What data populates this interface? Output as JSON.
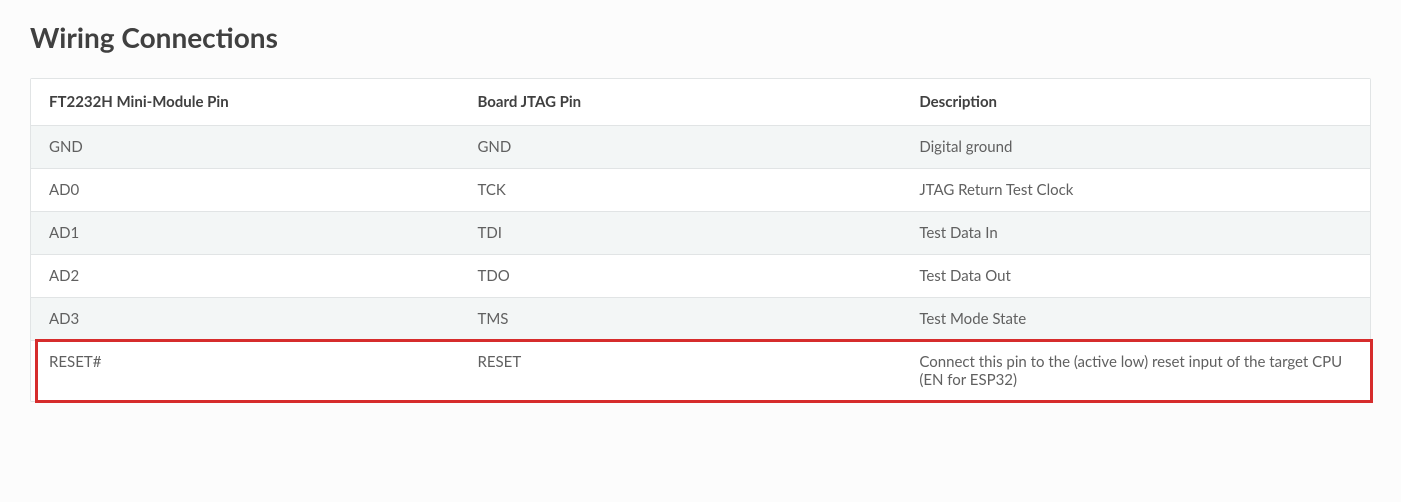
{
  "heading": "Wiring Connections",
  "table": {
    "headers": [
      "FT2232H Mini-Module Pin",
      "Board JTAG Pin",
      "Description"
    ],
    "rows": [
      [
        "GND",
        "GND",
        "Digital ground"
      ],
      [
        "AD0",
        "TCK",
        "JTAG Return Test Clock"
      ],
      [
        "AD1",
        "TDI",
        "Test Data In"
      ],
      [
        "AD2",
        "TDO",
        "Test Data Out"
      ],
      [
        "AD3",
        "TMS",
        "Test Mode State"
      ],
      [
        "RESET#",
        "RESET",
        "Connect this pin to the (active low) reset input of the target CPU (EN for ESP32)"
      ]
    ]
  }
}
